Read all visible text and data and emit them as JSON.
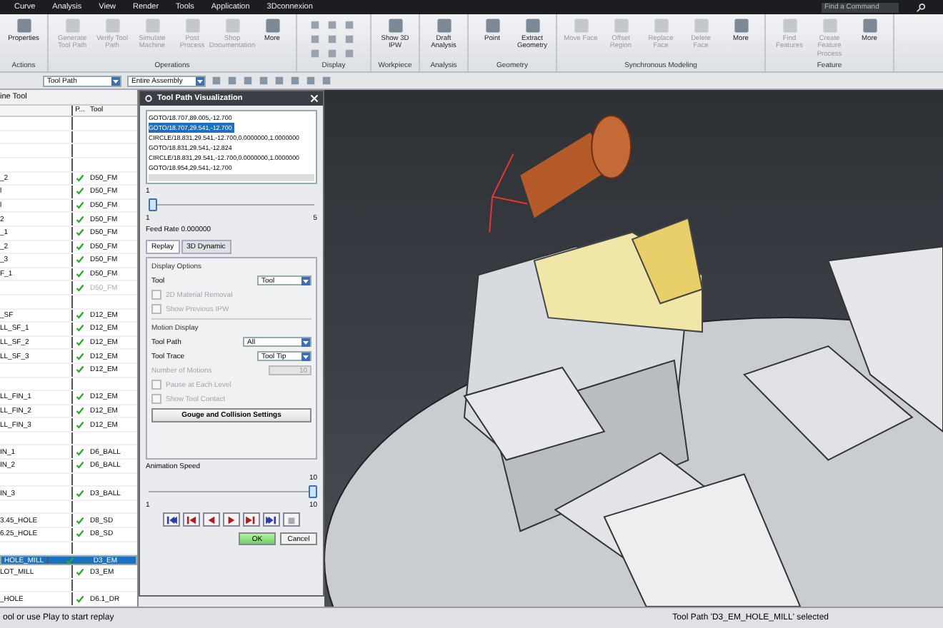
{
  "menu_bar": {
    "items": [
      "Curve",
      "Analysis",
      "View",
      "Render",
      "Tools",
      "Application",
      "3Dconnexion"
    ],
    "search": {
      "placeholder": "Find a Command"
    }
  },
  "ribbon": [
    {
      "label": "Actions",
      "buttons": [
        {
          "label": "Properties",
          "disabled": false
        }
      ]
    },
    {
      "label": "Operations",
      "buttons": [
        {
          "label": "Generate Tool Path",
          "disabled": true
        },
        {
          "label": "Verify Tool Path",
          "disabled": true
        },
        {
          "label": "Simulate Machine",
          "disabled": true
        },
        {
          "label": "Post Process",
          "disabled": true
        },
        {
          "label": "Shop Documentation",
          "disabled": true
        },
        {
          "label": "More",
          "disabled": false
        }
      ]
    },
    {
      "label": "Display"
    },
    {
      "label": "Workpiece",
      "buttons": [
        {
          "label": "Show 3D IPW",
          "disabled": false
        }
      ]
    },
    {
      "label": "Analysis",
      "buttons": [
        {
          "label": "Draft Analysis",
          "disabled": false
        }
      ]
    },
    {
      "label": "Geometry",
      "buttons": [
        {
          "label": "Point",
          "disabled": false
        },
        {
          "label": "Extract Geometry",
          "disabled": false
        }
      ]
    },
    {
      "label": "Synchronous Modeling",
      "buttons": [
        {
          "label": "Move Face",
          "disabled": true
        },
        {
          "label": "Offset Region",
          "disabled": true
        },
        {
          "label": "Replace Face",
          "disabled": true
        },
        {
          "label": "Delete Face",
          "disabled": true
        },
        {
          "label": "More",
          "disabled": false
        }
      ]
    },
    {
      "label": "Feature",
      "buttons": [
        {
          "label": "Find Features",
          "disabled": true
        },
        {
          "label": "Create Feature Process",
          "disabled": true
        },
        {
          "label": "More",
          "disabled": false
        }
      ]
    }
  ],
  "toolbar": {
    "selects": [
      "Tool Path",
      "Entire Assembly"
    ]
  },
  "navigator": {
    "title": "ine Tool",
    "columns": [
      "P...",
      "Tool"
    ],
    "rows": [
      {
        "kind": "gap"
      },
      {
        "kind": "gap"
      },
      {
        "kind": "gap"
      },
      {
        "kind": "gap"
      },
      {
        "kind": "item",
        "name": "_2",
        "tool": "D50_FM",
        "checked": true,
        "dimmed": false,
        "selected": false
      },
      {
        "kind": "item",
        "name": "l",
        "tool": "D50_FM",
        "checked": true,
        "dimmed": false,
        "selected": false
      },
      {
        "kind": "item",
        "name": "l",
        "tool": "D50_FM",
        "checked": true,
        "dimmed": false,
        "selected": false
      },
      {
        "kind": "item",
        "name": "2",
        "tool": "D50_FM",
        "checked": true,
        "dimmed": false,
        "selected": false
      },
      {
        "kind": "item",
        "name": "_1",
        "tool": "D50_FM",
        "checked": true,
        "dimmed": false,
        "selected": false
      },
      {
        "kind": "item",
        "name": "_2",
        "tool": "D50_FM",
        "checked": true,
        "dimmed": false,
        "selected": false
      },
      {
        "kind": "item",
        "name": "_3",
        "tool": "D50_FM",
        "checked": true,
        "dimmed": false,
        "selected": false
      },
      {
        "kind": "item",
        "name": "F_1",
        "tool": "D50_FM",
        "checked": true,
        "dimmed": false,
        "selected": false
      },
      {
        "kind": "item",
        "tool": "D50_FM",
        "checked": true,
        "dimmed": true,
        "selected": false
      },
      {
        "kind": "gap"
      },
      {
        "kind": "item",
        "name": "_SF",
        "tool": "D12_EM",
        "checked": true,
        "dimmed": false,
        "selected": false
      },
      {
        "kind": "item",
        "name": "LL_SF_1",
        "tool": "D12_EM",
        "checked": true,
        "dimmed": false,
        "selected": false
      },
      {
        "kind": "item",
        "name": "LL_SF_2",
        "tool": "D12_EM",
        "checked": true,
        "dimmed": false,
        "selected": false
      },
      {
        "kind": "item",
        "name": "LL_SF_3",
        "tool": "D12_EM",
        "checked": true,
        "dimmed": false,
        "selected": false
      },
      {
        "kind": "item",
        "tool": "D12_EM",
        "checked": true,
        "dimmed": false,
        "selected": false
      },
      {
        "kind": "gap"
      },
      {
        "kind": "item",
        "name": "LL_FIN_1",
        "tool": "D12_EM",
        "checked": true,
        "dimmed": false,
        "selected": false
      },
      {
        "kind": "item",
        "name": "LL_FIN_2",
        "tool": "D12_EM",
        "checked": true,
        "dimmed": false,
        "selected": false
      },
      {
        "kind": "item",
        "name": "LL_FIN_3",
        "tool": "D12_EM",
        "checked": true,
        "dimmed": false,
        "selected": false
      },
      {
        "kind": "gap"
      },
      {
        "kind": "item",
        "name": "IN_1",
        "tool": "D6_BALL",
        "checked": true,
        "dimmed": false,
        "selected": false
      },
      {
        "kind": "item",
        "name": "IN_2",
        "tool": "D6_BALL",
        "checked": true,
        "dimmed": false,
        "selected": false
      },
      {
        "kind": "gap"
      },
      {
        "kind": "item",
        "name": "IN_3",
        "tool": "D3_BALL",
        "checked": true,
        "dimmed": false,
        "selected": false
      },
      {
        "kind": "gap"
      },
      {
        "kind": "item",
        "name": "3.45_HOLE",
        "tool": "D8_SD",
        "checked": true,
        "dimmed": false,
        "selected": false
      },
      {
        "kind": "item",
        "name": "6.25_HOLE",
        "tool": "D8_SD",
        "checked": true,
        "dimmed": false,
        "selected": false
      },
      {
        "kind": "gap"
      },
      {
        "kind": "item",
        "name": "HOLE_MILL",
        "tool": "D3_EM",
        "checked": true,
        "dimmed": false,
        "selected": true
      },
      {
        "kind": "item",
        "name": "LOT_MILL",
        "tool": "D3_EM",
        "checked": true,
        "dimmed": false,
        "selected": false
      },
      {
        "kind": "gap"
      },
      {
        "kind": "item",
        "name": "_HOLE",
        "tool": "D6.1_DR",
        "checked": true,
        "dimmed": false,
        "selected": false
      }
    ]
  },
  "dialog": {
    "title": "Tool Path Visualization",
    "lines": [
      {
        "text": "GOTO/18.707,89.005,-12.700",
        "selected": false
      },
      {
        "text": "GOTO/18.707,29.541,-12.700",
        "selected": true
      },
      {
        "text": "CIRCLE/18.831,29.541,-12.700,0.0000000,1.0000000",
        "selected": false
      },
      {
        "text": "GOTO/18.831,29.541,-12.824",
        "selected": false
      },
      {
        "text": "CIRCLE/18.831,29.541,-12.700,0.0000000,1.0000000",
        "selected": false
      },
      {
        "text": "GOTO/18.954,29.541,-12.700",
        "selected": false
      }
    ],
    "position": {
      "current": "1",
      "min": "1",
      "max": "5",
      "level": 0
    },
    "feed_rate": "Feed Rate 0.000000",
    "tabs": [
      {
        "label": "Replay",
        "selected": true
      },
      {
        "label": "3D Dynamic",
        "selected": false
      }
    ],
    "display_options": {
      "heading": "Display Options",
      "tool_label": "Tool",
      "tool_value": "Tool",
      "checks": [
        {
          "label": "2D Material Removal",
          "checked": false,
          "disabled": true
        },
        {
          "label": "Show Previous IPW",
          "checked": false,
          "disabled": true
        }
      ]
    },
    "motion_display": {
      "heading": "Motion Display",
      "tool_path_label": "Tool Path",
      "tool_path_value": "All",
      "tool_trace_label": "Tool Trace",
      "tool_trace_value": "Tool Tip",
      "motions_label": "Number of Motions",
      "motions_value": "10",
      "checks": [
        {
          "label": "Pause at Each Level",
          "checked": false,
          "disabled": true
        },
        {
          "label": "Show Tool Contact",
          "checked": false,
          "disabled": true
        }
      ]
    },
    "gouge_button": "Gouge and Collision Settings",
    "speed": {
      "label": "Animation Speed",
      "current": "10",
      "min": "1",
      "max": "10",
      "level": 1
    },
    "playback": [
      {
        "kind": "first",
        "disabled": false
      },
      {
        "kind": "step-back",
        "disabled": false
      },
      {
        "kind": "reverse",
        "disabled": false
      },
      {
        "kind": "play",
        "disabled": false
      },
      {
        "kind": "step-forward",
        "disabled": false
      },
      {
        "kind": "last",
        "disabled": false
      },
      {
        "kind": "stop",
        "disabled": true
      }
    ],
    "buttons": [
      "OK",
      "Cancel"
    ]
  },
  "status_bar": {
    "left": "ool or use Play to start replay",
    "right": "Tool Path 'D3_EM_HOLE_MILL' selected"
  }
}
